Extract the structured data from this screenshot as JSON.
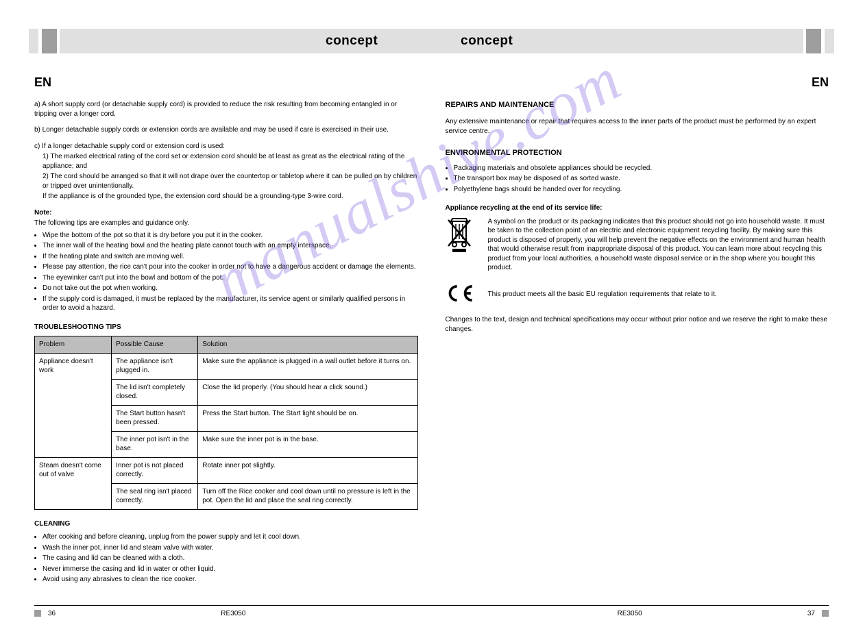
{
  "watermark": "manualshive.com",
  "header": {
    "brand_left": "concept",
    "brand_right": "concept"
  },
  "left": {
    "lang": "EN",
    "p1": "a) A short supply cord (or detachable supply cord) is provided to reduce the risk resulting from becoming entangled in or tripping over a longer cord.",
    "p2": "b) Longer detachable supply cords or extension cords are available and may be used if care is exercised in their use.",
    "p3": "c) If a longer detachable supply cord or extension cord is used:",
    "c1": "1) The marked electrical rating of the cord set or extension cord should be at least as great as the electrical rating of the appliance; and",
    "c2": "2) The cord should be arranged so that it will not drape over the countertop or tabletop where it can be pulled on by children or tripped over unintentionally.",
    "c3": "If the appliance is of the grounded type, the extension cord should be a grounding-type 3-wire cord.",
    "note_title": "Note:",
    "note_line1": "The following tips are examples and guidance only.",
    "bullets": [
      "Wipe the bottom of the pot so that it is dry before you put it in the cooker.",
      "The inner wall of the heating bowl and the heating plate cannot touch with an empty interspace.",
      "If the heating plate and switch are moving well.",
      "Please pay attention, the rice can't pour into the cooker in order not to have a dangerous accident or damage the elements.",
      "The eyewinker can't put into the bowl and bottom of the pot.",
      "Do not take out the pot when working.",
      "If the supply cord is damaged, it must be replaced by the manufacturer, its service agent or similarly qualified persons in order to avoid a hazard."
    ],
    "trouble_head": "TROUBLESHOOTING TIPS",
    "table": {
      "headers": [
        "Problem",
        "Possible Cause",
        "Solution"
      ],
      "rows": [
        {
          "problem": "Appliance doesn't work",
          "cause": "The appliance isn't plugged in.",
          "solution": "Make sure the appliance is plugged in a wall outlet before it turns on."
        },
        {
          "problem": "",
          "cause": "The lid isn't completely closed.",
          "solution": "Close the lid properly. (You should hear a click sound.)"
        },
        {
          "problem": "",
          "cause": "The Start button hasn't been pressed.",
          "solution": "Press the Start button. The Start light should be on."
        },
        {
          "problem": "",
          "cause": "The inner pot isn't in the base.",
          "solution": "Make sure the inner pot is in the base."
        },
        {
          "problem": "Steam doesn't come out of valve",
          "cause": "Inner pot is not placed correctly.",
          "solution": "Rotate inner pot slightly."
        },
        {
          "problem": "",
          "cause": "The seal ring isn't placed correctly.",
          "solution": "Turn off the Rice cooker and cool down until no pressure is left in the pot. Open the lid and place the seal ring correctly."
        }
      ]
    },
    "cleaning_head": "CLEANING",
    "cleaning_bullets": [
      "After cooking and before cleaning, unplug from the power supply and let it cool down.",
      "Wash the inner pot, inner lid and steam valve with water.",
      "The casing and lid can be cleaned with a cloth.",
      "Never immerse the casing and lid in water or other liquid.",
      "Avoid using any abrasives to clean the rice cooker."
    ]
  },
  "right": {
    "lang": "EN",
    "service_head": "REPAIRS AND MAINTENANCE",
    "service_p1": "Any extensive maintenance or repair that requires access to the inner parts of the product must be performed by an expert service centre.",
    "env_head": "ENVIRONMENTAL PROTECTION",
    "env_p1": "Packaging materials and obsolete appliances should be recycled.",
    "env_p2": "The transport box may be disposed of as sorted waste.",
    "env_p3": "Polyethylene bags should be handed over for recycling.",
    "recycle_head": "Appliance recycling at the end of its service life:",
    "recycle_text": "A symbol on the product or its packaging indicates that this product should not go into household waste. It must be taken to the collection point of an electric and electronic equipment recycling facility. By making sure this product is disposed of properly, you will help prevent the negative effects on the environment and human health that would otherwise result from inappropriate disposal of this product. You can learn more about recycling this product from your local authorities, a household waste disposal service or in the shop where you bought this product.",
    "ce_text": "This product meets all the basic EU regulation requirements that relate to it.",
    "changes_text": "Changes to the text, design and technical specifications may occur without prior notice and we reserve the right to make these changes."
  },
  "footer": {
    "page_left": "36",
    "page_right": "37",
    "model_left": "RE3050",
    "model_right": "RE3050"
  }
}
